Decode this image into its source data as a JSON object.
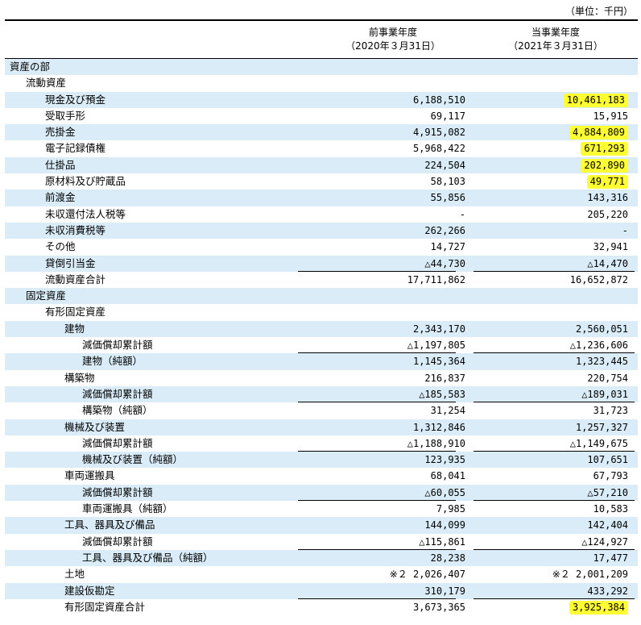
{
  "unit_label": "（単位：千円）",
  "header": {
    "prev_title": "前事業年度",
    "prev_date": "（2020年３月31日）",
    "curr_title": "当事業年度",
    "curr_date": "（2021年３月31日）"
  },
  "rows": [
    {
      "label": "資産の部",
      "indent": 0,
      "prev": "",
      "curr": "",
      "shade": true,
      "hl": false,
      "ul": false
    },
    {
      "label": "流動資産",
      "indent": 1,
      "prev": "",
      "curr": "",
      "shade": false,
      "hl": false,
      "ul": false
    },
    {
      "label": "現金及び預金",
      "indent": 2,
      "prev": "6,188,510",
      "curr": "10,461,183",
      "shade": true,
      "hl": true,
      "ul": false
    },
    {
      "label": "受取手形",
      "indent": 2,
      "prev": "69,117",
      "curr": "15,915",
      "shade": false,
      "hl": false,
      "ul": false
    },
    {
      "label": "売掛金",
      "indent": 2,
      "prev": "4,915,082",
      "curr": "4,884,809",
      "shade": true,
      "hl": true,
      "ul": false
    },
    {
      "label": "電子記録債権",
      "indent": 2,
      "prev": "5,968,422",
      "curr": "671,293",
      "shade": false,
      "hl": true,
      "ul": false
    },
    {
      "label": "仕掛品",
      "indent": 2,
      "prev": "224,504",
      "curr": "202,890",
      "shade": true,
      "hl": true,
      "ul": false
    },
    {
      "label": "原材料及び貯蔵品",
      "indent": 2,
      "prev": "58,103",
      "curr": "49,771",
      "shade": false,
      "hl": true,
      "ul": false
    },
    {
      "label": "前渡金",
      "indent": 2,
      "prev": "55,856",
      "curr": "143,316",
      "shade": true,
      "hl": false,
      "ul": false
    },
    {
      "label": "未収還付法人税等",
      "indent": 2,
      "prev": "-",
      "curr": "205,220",
      "shade": false,
      "hl": false,
      "ul": false
    },
    {
      "label": "未収消費税等",
      "indent": 2,
      "prev": "262,266",
      "curr": "-",
      "shade": true,
      "hl": false,
      "ul": false
    },
    {
      "label": "その他",
      "indent": 2,
      "prev": "14,727",
      "curr": "32,941",
      "shade": false,
      "hl": false,
      "ul": false
    },
    {
      "label": "貸倒引当金",
      "indent": 2,
      "prev": "△44,730",
      "curr": "△14,470",
      "shade": true,
      "hl": false,
      "ul": true
    },
    {
      "label": "流動資産合計",
      "indent": 2,
      "prev": "17,711,862",
      "curr": "16,652,872",
      "shade": false,
      "hl": false,
      "ul": false
    },
    {
      "label": "固定資産",
      "indent": 1,
      "prev": "",
      "curr": "",
      "shade": true,
      "hl": false,
      "ul": false
    },
    {
      "label": "有形固定資産",
      "indent": 2,
      "prev": "",
      "curr": "",
      "shade": false,
      "hl": false,
      "ul": false
    },
    {
      "label": "建物",
      "indent": 3,
      "prev": "2,343,170",
      "curr": "2,560,051",
      "shade": true,
      "hl": false,
      "ul": false
    },
    {
      "label": "減価償却累計額",
      "indent": 4,
      "prev": "△1,197,805",
      "curr": "△1,236,606",
      "shade": false,
      "hl": false,
      "ul": true
    },
    {
      "label": "建物（純額）",
      "indent": 4,
      "prev": "1,145,364",
      "curr": "1,323,445",
      "shade": true,
      "hl": false,
      "ul": false
    },
    {
      "label": "構築物",
      "indent": 3,
      "prev": "216,837",
      "curr": "220,754",
      "shade": false,
      "hl": false,
      "ul": false
    },
    {
      "label": "減価償却累計額",
      "indent": 4,
      "prev": "△185,583",
      "curr": "△189,031",
      "shade": true,
      "hl": false,
      "ul": true
    },
    {
      "label": "構築物（純額）",
      "indent": 4,
      "prev": "31,254",
      "curr": "31,723",
      "shade": false,
      "hl": false,
      "ul": false
    },
    {
      "label": "機械及び装置",
      "indent": 3,
      "prev": "1,312,846",
      "curr": "1,257,327",
      "shade": true,
      "hl": false,
      "ul": false
    },
    {
      "label": "減価償却累計額",
      "indent": 4,
      "prev": "△1,188,910",
      "curr": "△1,149,675",
      "shade": false,
      "hl": false,
      "ul": true
    },
    {
      "label": "機械及び装置（純額）",
      "indent": 4,
      "prev": "123,935",
      "curr": "107,651",
      "shade": true,
      "hl": false,
      "ul": false
    },
    {
      "label": "車両運搬具",
      "indent": 3,
      "prev": "68,041",
      "curr": "67,793",
      "shade": false,
      "hl": false,
      "ul": false
    },
    {
      "label": "減価償却累計額",
      "indent": 4,
      "prev": "△60,055",
      "curr": "△57,210",
      "shade": true,
      "hl": false,
      "ul": true
    },
    {
      "label": "車両運搬具（純額）",
      "indent": 4,
      "prev": "7,985",
      "curr": "10,583",
      "shade": false,
      "hl": false,
      "ul": false
    },
    {
      "label": "工具、器具及び備品",
      "indent": 3,
      "prev": "144,099",
      "curr": "142,404",
      "shade": true,
      "hl": false,
      "ul": false
    },
    {
      "label": "減価償却累計額",
      "indent": 4,
      "prev": "△115,861",
      "curr": "△124,927",
      "shade": false,
      "hl": false,
      "ul": true
    },
    {
      "label": "工具、器具及び備品（純額）",
      "indent": 4,
      "prev": "28,238",
      "curr": "17,477",
      "shade": true,
      "hl": false,
      "ul": false
    },
    {
      "label": "土地",
      "indent": 3,
      "prev": "※２ 2,026,407",
      "curr": "※２ 2,001,209",
      "shade": false,
      "hl": false,
      "ul": false
    },
    {
      "label": "建設仮勘定",
      "indent": 3,
      "prev": "310,179",
      "curr": "433,292",
      "shade": true,
      "hl": false,
      "ul": true
    },
    {
      "label": "有形固定資産合計",
      "indent": 3,
      "prev": "3,673,365",
      "curr": "3,925,384",
      "shade": false,
      "hl": true,
      "ul": false
    }
  ]
}
